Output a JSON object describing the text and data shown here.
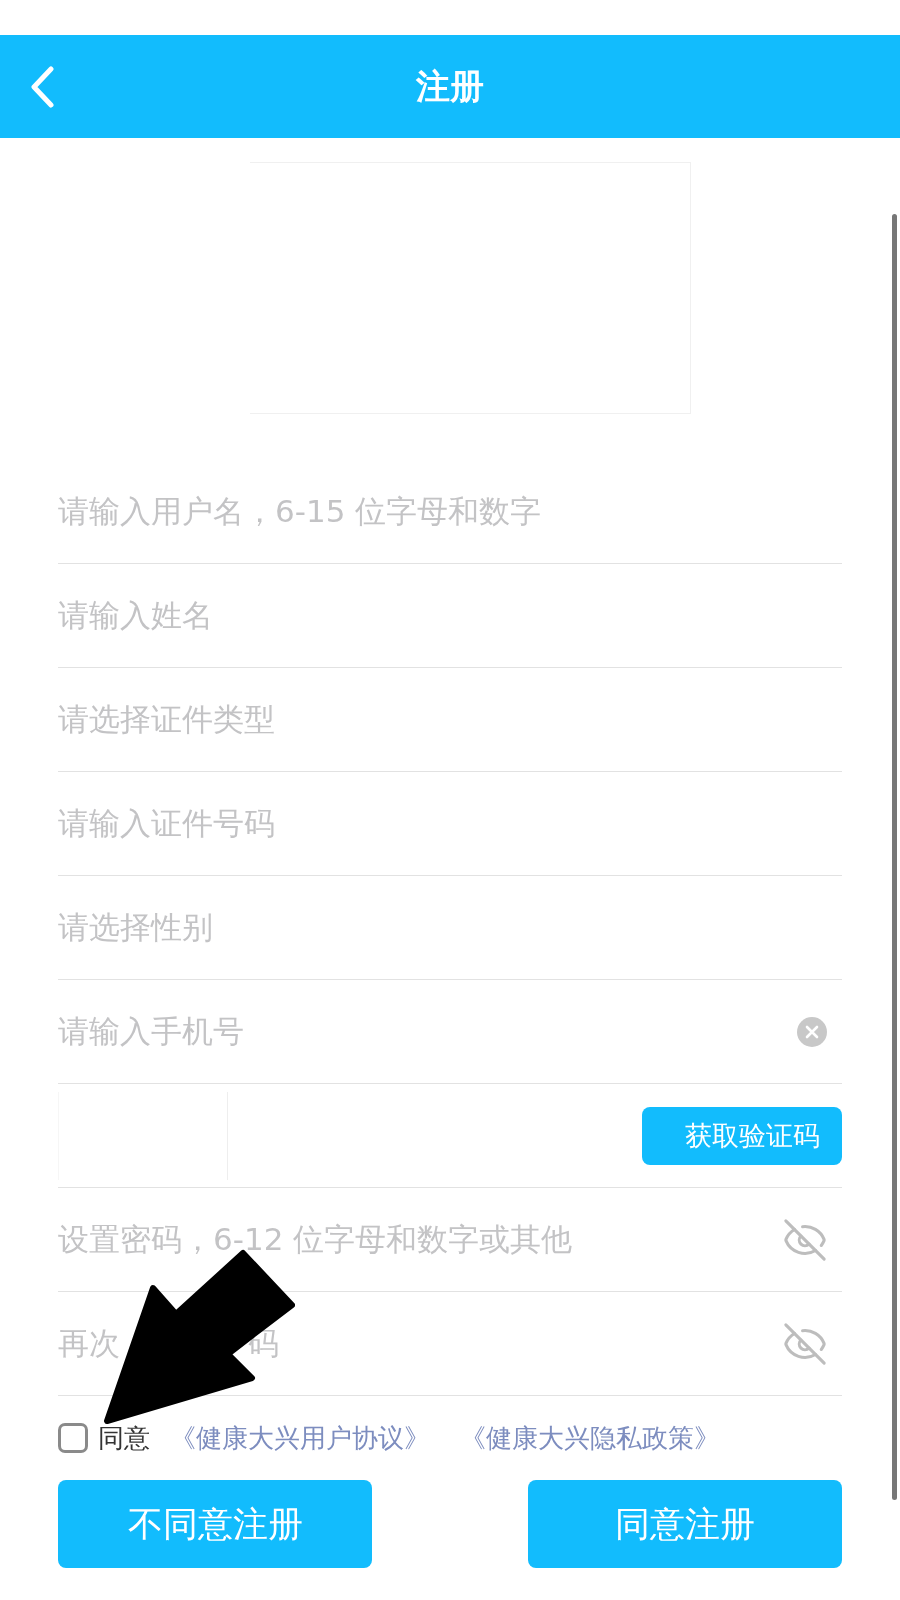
{
  "header": {
    "title": "注册"
  },
  "fields": [
    {
      "kind": "text",
      "placeholder": "请输入用户名，6-15 位字母和数字"
    },
    {
      "kind": "text",
      "placeholder": "请输入姓名"
    },
    {
      "kind": "text",
      "placeholder": "请选择证件类型"
    },
    {
      "kind": "text",
      "placeholder": "请输入证件号码"
    },
    {
      "kind": "text",
      "placeholder": "请选择性别"
    },
    {
      "kind": "clear",
      "placeholder": "请输入手机号"
    },
    {
      "kind": "code",
      "button": "获取验证码"
    },
    {
      "kind": "password",
      "placeholder": "设置密码，6-12 位字母和数字或其他"
    },
    {
      "kind": "password",
      "placeholder_parts": [
        "再次",
        "码"
      ]
    }
  ],
  "agreement": {
    "checked": false,
    "label": "同意",
    "links": [
      "《健康大兴用户协议》",
      "《健康大兴隐私政策》"
    ]
  },
  "buttons": [
    "不同意注册",
    "同意注册"
  ]
}
